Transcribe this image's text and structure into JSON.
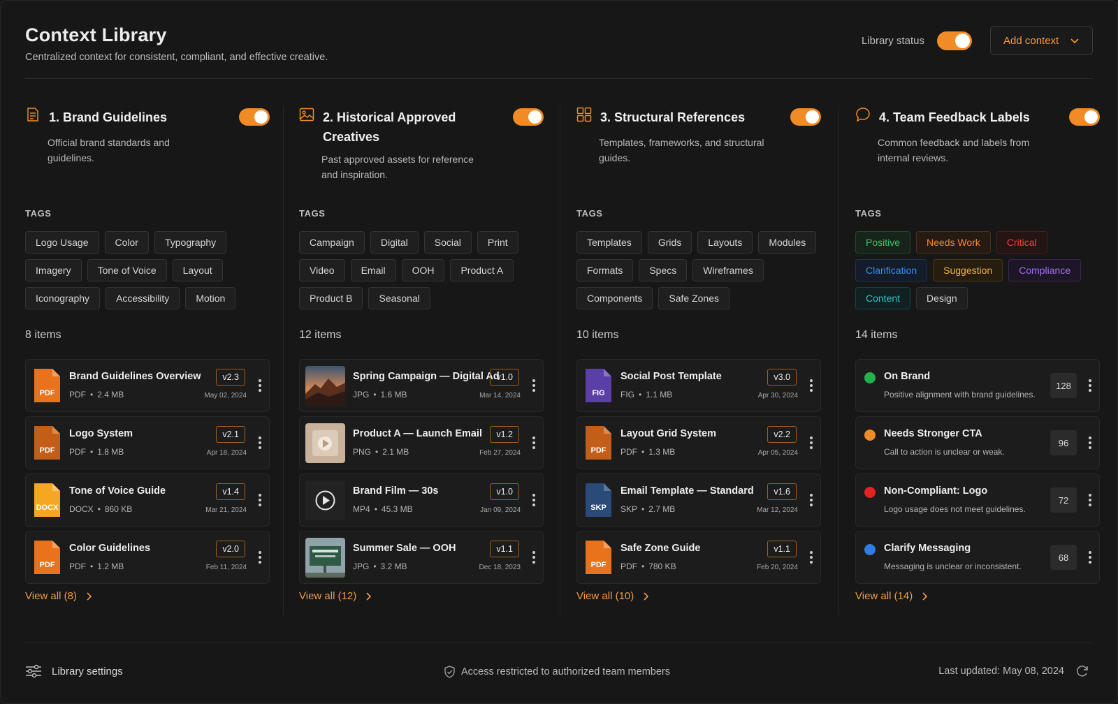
{
  "header": {
    "title": "Context Library",
    "subtitle": "Centralized context for consistent, compliant, and effective creative.",
    "status_label": "Library status",
    "status_on": true,
    "add_button": "Add context"
  },
  "columns": [
    {
      "title": "1. Brand Guidelines",
      "description": "Official brand standards and guidelines.",
      "tags_label": "TAGS",
      "tags": [
        "Logo Usage",
        "Color",
        "Typography",
        "Imagery",
        "Tone of Voice",
        "Layout",
        "Iconography",
        "Accessibility",
        "Motion"
      ],
      "count": "8 items",
      "view_all": "View all (8)",
      "items": [
        {
          "name": "Brand Guidelines Overview",
          "ext": "PDF",
          "size": "2.4 MB",
          "version": "v2.3",
          "date": "May 02, 2024"
        },
        {
          "name": "Logo System",
          "ext": "PDF",
          "size": "1.8 MB",
          "version": "v2.1",
          "date": "Apr 18, 2024"
        },
        {
          "name": "Tone of Voice Guide",
          "ext": "DOCX",
          "size": "860 KB",
          "version": "v1.4",
          "date": "Mar 21, 2024"
        },
        {
          "name": "Color Guidelines",
          "ext": "PDF",
          "size": "1.2 MB",
          "version": "v2.0",
          "date": "Feb 11, 2024"
        }
      ]
    },
    {
      "title": "2. Historical Approved Creatives",
      "description": "Past approved assets for reference and inspiration.",
      "tags_label": "TAGS",
      "tags": [
        "Campaign",
        "Digital",
        "Social",
        "Print",
        "Video",
        "Email",
        "OOH",
        "Product A",
        "Product B",
        "Seasonal"
      ],
      "count": "12 items",
      "view_all": "View all (12)",
      "items": [
        {
          "name": "Spring Campaign — Digital Ad",
          "ext": "JPG",
          "size": "1.6 MB",
          "version": "v1.0",
          "date": "Mar 14, 2024"
        },
        {
          "name": "Product A — Launch Email",
          "ext": "PNG",
          "size": "2.1 MB",
          "version": "v1.2",
          "date": "Feb 27, 2024"
        },
        {
          "name": "Brand Film — 30s",
          "ext": "MP4",
          "size": "45.3 MB",
          "version": "v1.0",
          "date": "Jan 09, 2024"
        },
        {
          "name": "Summer Sale — OOH",
          "ext": "JPG",
          "size": "3.2 MB",
          "version": "v1.1",
          "date": "Dec 18, 2023"
        }
      ]
    },
    {
      "title": "3. Structural References",
      "description": "Templates, frameworks, and structural guides.",
      "tags_label": "TAGS",
      "tags": [
        "Templates",
        "Grids",
        "Layouts",
        "Modules",
        "Formats",
        "Specs",
        "Wireframes",
        "Components",
        "Safe Zones"
      ],
      "count": "10 items",
      "view_all": "View all (10)",
      "items": [
        {
          "name": "Social Post Template",
          "ext": "FIG",
          "size": "1.1 MB",
          "version": "v3.0",
          "date": "Apr 30, 2024"
        },
        {
          "name": "Layout Grid System",
          "ext": "PDF",
          "size": "1.3 MB",
          "version": "v2.2",
          "date": "Apr 05, 2024"
        },
        {
          "name": "Email Template — Standard",
          "ext": "SKP",
          "size": "2.7 MB",
          "version": "v1.6",
          "date": "Mar 12, 2024"
        },
        {
          "name": "Safe Zone Guide",
          "ext": "PDF",
          "size": "780 KB",
          "version": "v1.1",
          "date": "Feb 20, 2024"
        }
      ]
    },
    {
      "title": "4. Team Feedback Labels",
      "description": "Common feedback and labels from internal reviews.",
      "tags_label": "TAGS",
      "tags": [
        "Positive",
        "Needs Work",
        "Critical",
        "Clarification",
        "Suggestion",
        "Compliance",
        "Content",
        "Design"
      ],
      "count": "14 items",
      "view_all": "View all (14)",
      "items": [
        {
          "name": "On Brand",
          "desc": "Positive alignment with brand guidelines.",
          "count": "128",
          "color": "#22b14c"
        },
        {
          "name": "Needs Stronger CTA",
          "desc": "Call to action is unclear or weak.",
          "count": "96",
          "color": "#f08b26"
        },
        {
          "name": "Non-Compliant: Logo",
          "desc": "Logo usage does not meet guidelines.",
          "count": "72",
          "color": "#e52222"
        },
        {
          "name": "Clarify Messaging",
          "desc": "Messaging is unclear or inconsistent.",
          "count": "68",
          "color": "#2f7de0"
        }
      ]
    }
  ],
  "footer": {
    "settings": "Library settings",
    "access": "Access restricted to authorized team members",
    "updated": "Last updated: May 08, 2024"
  },
  "colors": {
    "accent": "#f08b26",
    "pdf": "#e8731c",
    "docx": "#f5a623",
    "fig": "#5b3fa8",
    "skp": "#2a4a78"
  }
}
